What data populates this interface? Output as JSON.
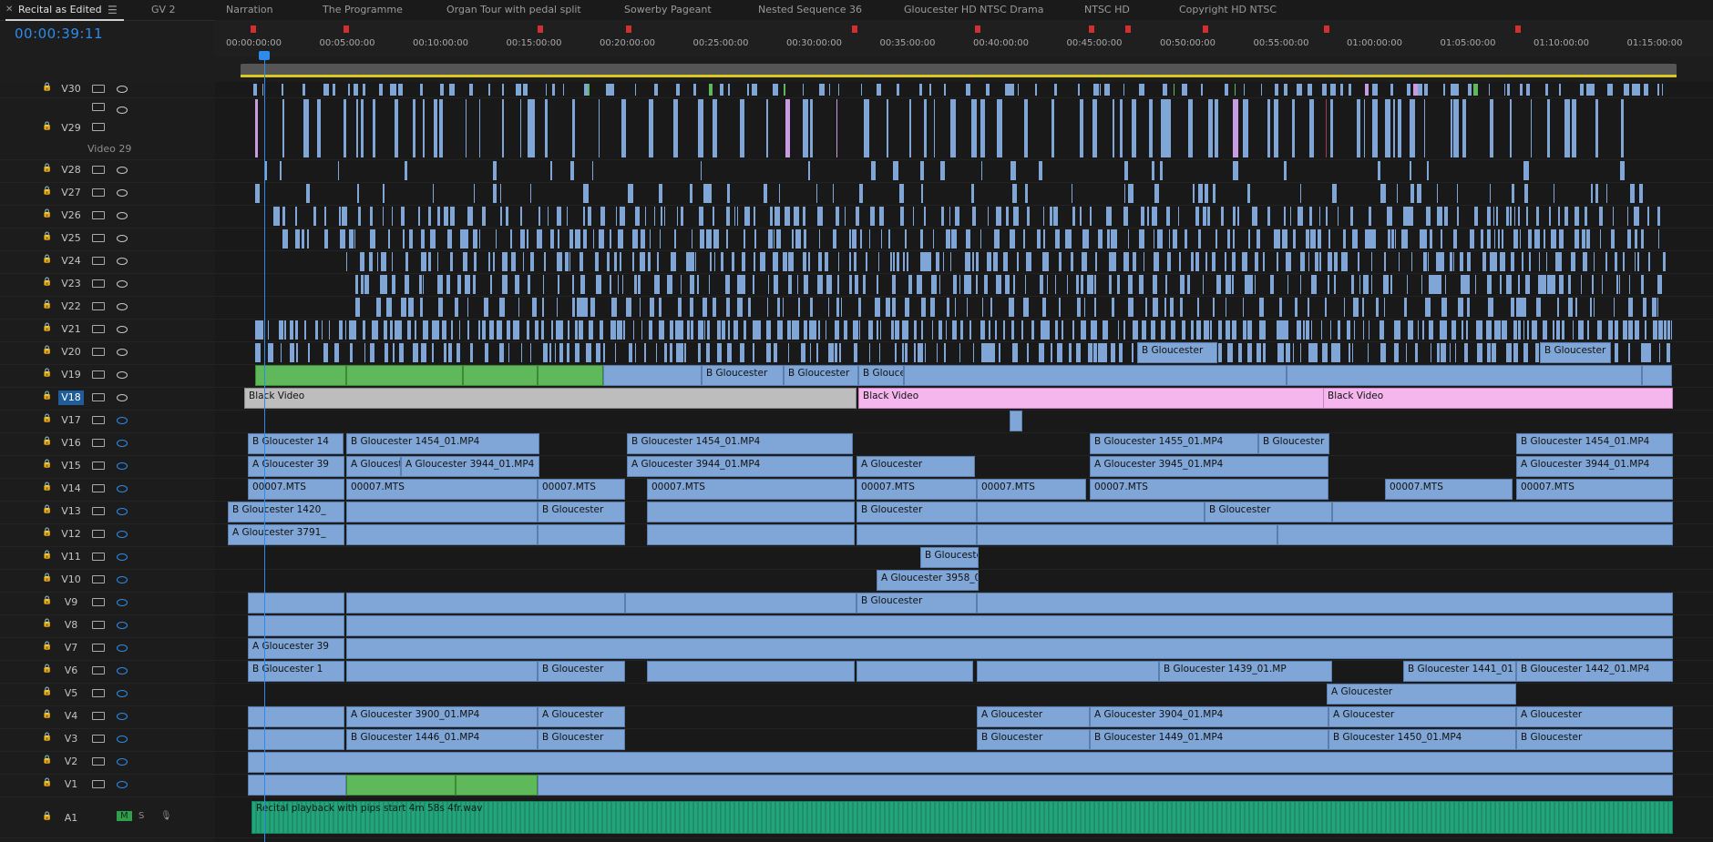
{
  "tabs": [
    {
      "label": "Recital as Edited",
      "active": true
    },
    {
      "label": "GV 2"
    },
    {
      "label": "Narration"
    },
    {
      "label": "The Programme"
    },
    {
      "label": "Organ Tour with pedal split"
    },
    {
      "label": "Sowerby Pageant"
    },
    {
      "label": "Nested Sequence 36"
    },
    {
      "label": "Gloucester HD NTSC Drama"
    },
    {
      "label": "NTSC HD"
    },
    {
      "label": "Copyright HD NTSC"
    }
  ],
  "timecode": "00:00:39:11",
  "ruler": {
    "labels": [
      "00:00:00:00",
      "00:05:00:00",
      "00:10:00:00",
      "00:15:00:00",
      "00:20:00:00",
      "00:25:00:00",
      "00:30:00:00",
      "00:35:00:00",
      "00:40:00:00",
      "00:45:00:00",
      "00:50:00:00",
      "00:55:00:00",
      "01:00:00:00",
      "01:05:00:00",
      "01:10:00:00",
      "01:15:00:00"
    ]
  },
  "tools": [
    "snap-icon",
    "link-icon",
    "linked-selection-icon",
    "marker-icon",
    "wrench-icon"
  ],
  "tracks": [
    {
      "name": "V30",
      "eye": "on"
    },
    {
      "name": "V29",
      "eye": "on",
      "sub": "Video 29"
    },
    {
      "name": "V28",
      "eye": "on"
    },
    {
      "name": "V27",
      "eye": "on"
    },
    {
      "name": "V26",
      "eye": "on"
    },
    {
      "name": "V25",
      "eye": "on"
    },
    {
      "name": "V24",
      "eye": "on"
    },
    {
      "name": "V23",
      "eye": "on"
    },
    {
      "name": "V22",
      "eye": "on"
    },
    {
      "name": "V21",
      "eye": "on"
    },
    {
      "name": "V20",
      "eye": "on"
    },
    {
      "name": "V19",
      "eye": "on"
    },
    {
      "name": "V18",
      "eye": "on",
      "selected": true
    },
    {
      "name": "V17",
      "eye": "off"
    },
    {
      "name": "V16",
      "eye": "off"
    },
    {
      "name": "V15",
      "eye": "off"
    },
    {
      "name": "V14",
      "eye": "off"
    },
    {
      "name": "V13",
      "eye": "off"
    },
    {
      "name": "V12",
      "eye": "off"
    },
    {
      "name": "V11",
      "eye": "off"
    },
    {
      "name": "V10",
      "eye": "off"
    },
    {
      "name": "V9",
      "eye": "off"
    },
    {
      "name": "V8",
      "eye": "off"
    },
    {
      "name": "V7",
      "eye": "off"
    },
    {
      "name": "V6",
      "eye": "off"
    },
    {
      "name": "V5",
      "eye": "off"
    },
    {
      "name": "V4",
      "eye": "off"
    },
    {
      "name": "V3",
      "eye": "off"
    },
    {
      "name": "V2",
      "eye": "off"
    },
    {
      "name": "V1",
      "eye": "off"
    },
    {
      "name": "A1",
      "eye": "audio"
    }
  ],
  "clip_labels": {
    "black_video": "Black Video",
    "b_gloucester_1454": "B Gloucester 1454_01.MP4",
    "b_gloucester_1455": "B Gloucester 1455_01.MP4",
    "a_gloucester_3944": "A Gloucester 3944_01.MP4",
    "a_gloucester_3945": "A Gloucester 3945_01.MP4",
    "mts": "00007.MTS",
    "b_gloucester_1420": "B Gloucester 1420_",
    "a_gloucester_3791": "A Gloucester 3791_",
    "a_gloucester_3958": "A Gloucester 3958_0",
    "b_gloucester_1439": "B Gloucester 1439_01.MP",
    "b_gloucester_1441": "B Gloucester 1441_01",
    "b_gloucester_1442": "B Gloucester 1442_01.MP4",
    "a_gloucester_3900": "A Gloucester 3900_01.MP4",
    "a_gloucester_3904": "A Gloucester 3904_01.MP4",
    "b_gloucester_1446": "B Gloucester 1446_01.MP4",
    "b_gloucester_1449": "B Gloucester 1449_01.MP4",
    "b_gloucester_1450": "B Gloucester 1450_01.MP4",
    "a_gloucester_short": "A Gloucester",
    "b_gloucester_short": "B Gloucester",
    "b_gloucester_1454_trunc": "B Gloucester 14",
    "a_gloucester_39_trunc": "A Gloucester 39",
    "b_gloucester_trunc": "B Gloucester 1",
    "audio_clip": "Recital playback with pips start 4m 58s 4fr.wav"
  },
  "colors": {
    "clip_blue": "#7fa6d6",
    "clip_pink": "#f5b6ee",
    "clip_gray": "#bdbdbd",
    "clip_green": "#5fb85a",
    "audio_green": "#22a57b",
    "playhead_blue": "#2d8ceb",
    "marker_red": "#d03030"
  }
}
